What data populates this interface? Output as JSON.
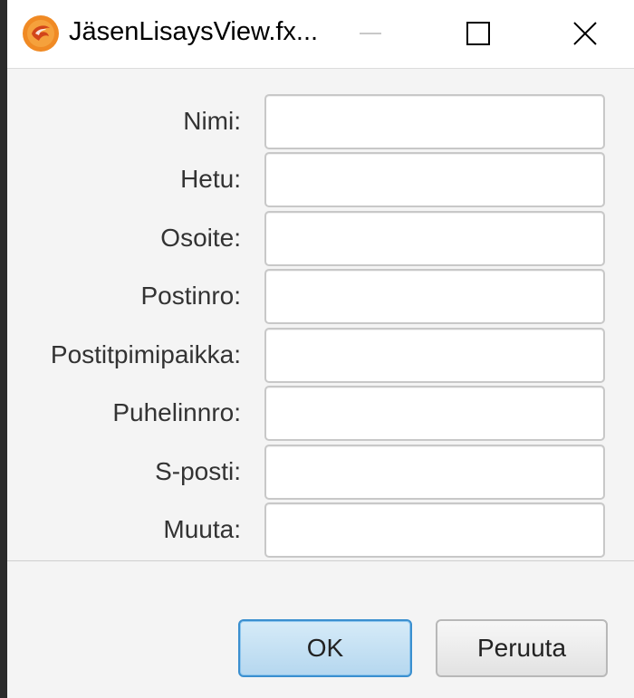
{
  "window": {
    "title": "JäsenLisaysView.fx...",
    "app_icon": "javafx-flame-icon",
    "controls": {
      "minimize_icon": "minimize-icon",
      "maximize_icon": "maximize-icon",
      "close_icon": "close-icon"
    }
  },
  "form": {
    "fields": [
      {
        "label": "Nimi:",
        "value": ""
      },
      {
        "label": "Hetu:",
        "value": ""
      },
      {
        "label": "Osoite:",
        "value": ""
      },
      {
        "label": "Postinro:",
        "value": ""
      },
      {
        "label": "Postitpimipaikka:",
        "value": ""
      },
      {
        "label": "Puhelinnro:",
        "value": ""
      },
      {
        "label": "S-posti:",
        "value": ""
      },
      {
        "label": "Muuta:",
        "value": ""
      }
    ]
  },
  "buttons": {
    "ok_label": "OK",
    "cancel_label": "Peruuta"
  },
  "colors": {
    "accent": "#3a8fcf",
    "content_bg": "#f4f4f4",
    "icon_orange": "#f08a24"
  }
}
